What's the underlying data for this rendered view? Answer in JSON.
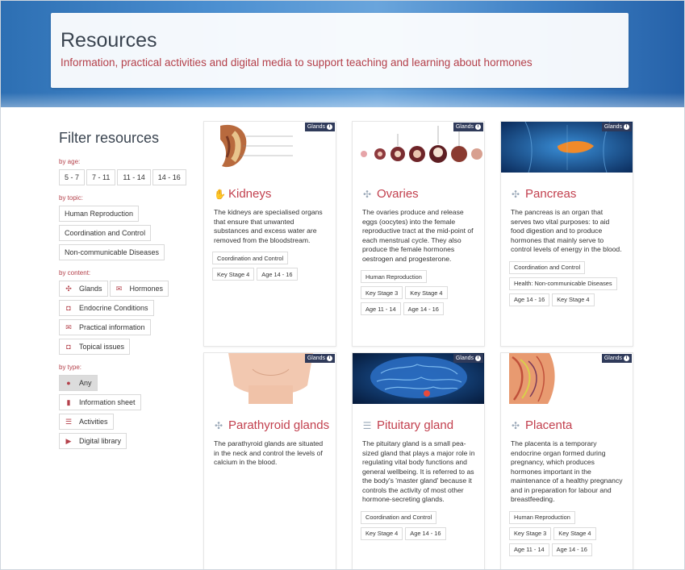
{
  "header": {
    "title": "Resources",
    "subtitle": "Information, practical activities and digital media to support teaching and learning about hormones"
  },
  "filter": {
    "title": "Filter resources",
    "age": {
      "label": "by age:",
      "options": [
        "5 - 7",
        "7 - 11",
        "11 - 14",
        "14 - 16"
      ]
    },
    "topic": {
      "label": "by topic:",
      "options": [
        "Human Reproduction",
        "Coordination and Control",
        "Non-communicable Diseases"
      ]
    },
    "content": {
      "label": "by content:",
      "options": [
        {
          "label": "Glands",
          "icon": "glands-icon"
        },
        {
          "label": "Hormones",
          "icon": "hormones-icon"
        },
        {
          "label": "Endocrine Conditions",
          "icon": "conditions-icon"
        },
        {
          "label": "Practical information",
          "icon": "practical-icon"
        },
        {
          "label": "Topical issues",
          "icon": "topical-icon"
        }
      ]
    },
    "type": {
      "label": "by type:",
      "options": [
        {
          "label": "Any",
          "icon": "any-icon",
          "selected": true
        },
        {
          "label": "Information sheet",
          "icon": "document-icon"
        },
        {
          "label": "Activities",
          "icon": "list-icon"
        },
        {
          "label": "Digital library",
          "icon": "play-icon"
        }
      ]
    }
  },
  "cards": [
    {
      "badge": "Glands",
      "title": "Kidneys",
      "icon": "hand-icon",
      "description": "The kidneys are specialised organs that ensure that unwanted substances and excess water are removed from the bloodstream.",
      "tag_rows": [
        [
          "Coordination and Control"
        ],
        [
          "Key Stage 4",
          "Age 14 - 16"
        ]
      ]
    },
    {
      "badge": "Glands",
      "title": "Ovaries",
      "icon": "glands-icon",
      "description": "The ovaries produce and release eggs (oocytes) into the female reproductive tract at the mid-point of each menstrual cycle. They also produce the female hormones oestrogen and progesterone.",
      "tag_rows": [
        [
          "Human Reproduction"
        ],
        [
          "Key Stage 3",
          "Key Stage 4"
        ],
        [
          "Age 11 - 14",
          "Age 14 - 16"
        ]
      ]
    },
    {
      "badge": "Glands",
      "title": "Pancreas",
      "icon": "glands-icon",
      "description": "The pancreas is an organ that serves two vital purposes: to aid food digestion and to produce hormones that mainly serve to control levels of energy in the blood.",
      "tag_rows": [
        [
          "Coordination and Control"
        ],
        [
          "Health: Non-communicable Diseases"
        ],
        [
          "Age 14 - 16",
          "Key Stage 4"
        ]
      ]
    },
    {
      "badge": "Glands",
      "title": "Parathyroid glands",
      "icon": "glands-icon",
      "description": "The parathyroid glands are situated in the neck and control the levels of calcium in the blood.",
      "tag_rows": []
    },
    {
      "badge": "Glands",
      "title": "Pituitary gland",
      "icon": "list-icon",
      "description": "The pituitary gland is a small pea-sized gland that plays a major role in regulating vital body functions and general wellbeing. It is referred to as the body's 'master gland' because it controls the activity of most other hormone-secreting glands.",
      "tag_rows": [
        [
          "Coordination and Control"
        ],
        [
          "Key Stage 4",
          "Age 14 - 16"
        ]
      ]
    },
    {
      "badge": "Glands",
      "title": "Placenta",
      "icon": "glands-icon",
      "description": "The placenta is a temporary endocrine organ formed during pregnancy, which produces hormones important in the maintenance of a healthy pregnancy and in preparation for labour and breastfeeding.",
      "tag_rows": [
        [
          "Human Reproduction"
        ],
        [
          "Key Stage 3",
          "Key Stage 4"
        ],
        [
          "Age 11 - 14",
          "Age 14 - 16"
        ]
      ]
    }
  ],
  "colors": {
    "accent": "#c2404e",
    "badge": "#2f3a5a",
    "header_blue": "#3d7fc4"
  }
}
